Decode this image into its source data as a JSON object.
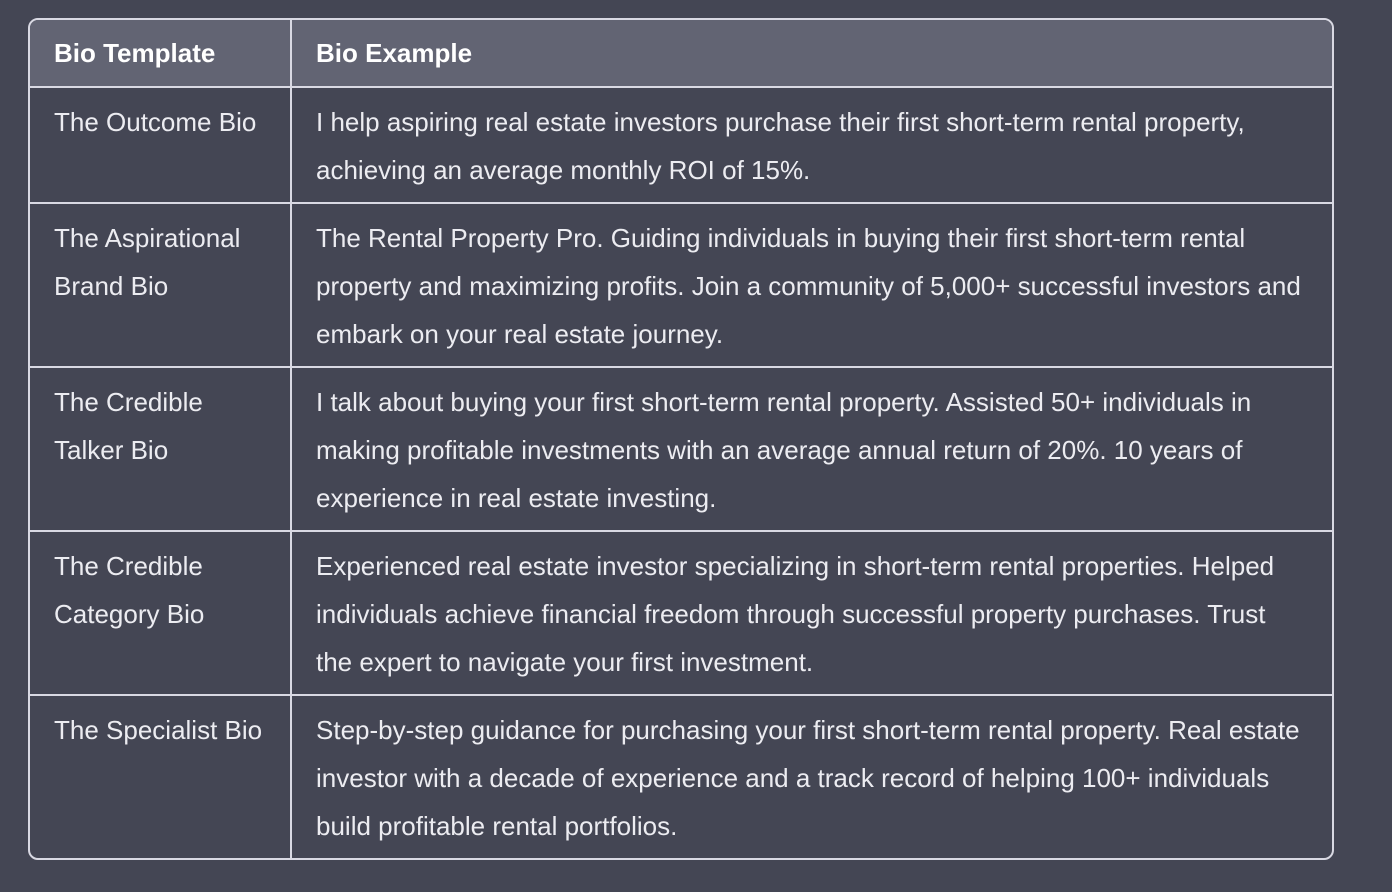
{
  "table": {
    "headers": [
      "Bio Template",
      "Bio Example"
    ],
    "rows": [
      {
        "template": "The Outcome Bio",
        "example": "I help aspiring real estate investors purchase their first short-term rental property, achieving an average monthly ROI of 15%."
      },
      {
        "template": "The Aspirational Brand Bio",
        "example": "The Rental Property Pro. Guiding individuals in buying their first short-term rental property and maximizing profits. Join a community of 5,000+ successful investors and embark on your real estate journey."
      },
      {
        "template": "The Credible Talker Bio",
        "example": "I talk about buying your first short-term rental property. Assisted 50+ individuals in making profitable investments with an average annual return of 20%. 10 years of experience in real estate investing."
      },
      {
        "template": "The Credible Category Bio",
        "example": "Experienced real estate investor specializing in short-term rental properties. Helped individuals achieve financial freedom through successful property purchases. Trust the expert to navigate your first investment."
      },
      {
        "template": "The Specialist Bio",
        "example": "Step-by-step guidance for purchasing your first short-term rental property. Real estate investor with a decade of experience and a track record of helping 100+ individuals build profitable rental portfolios."
      }
    ]
  }
}
